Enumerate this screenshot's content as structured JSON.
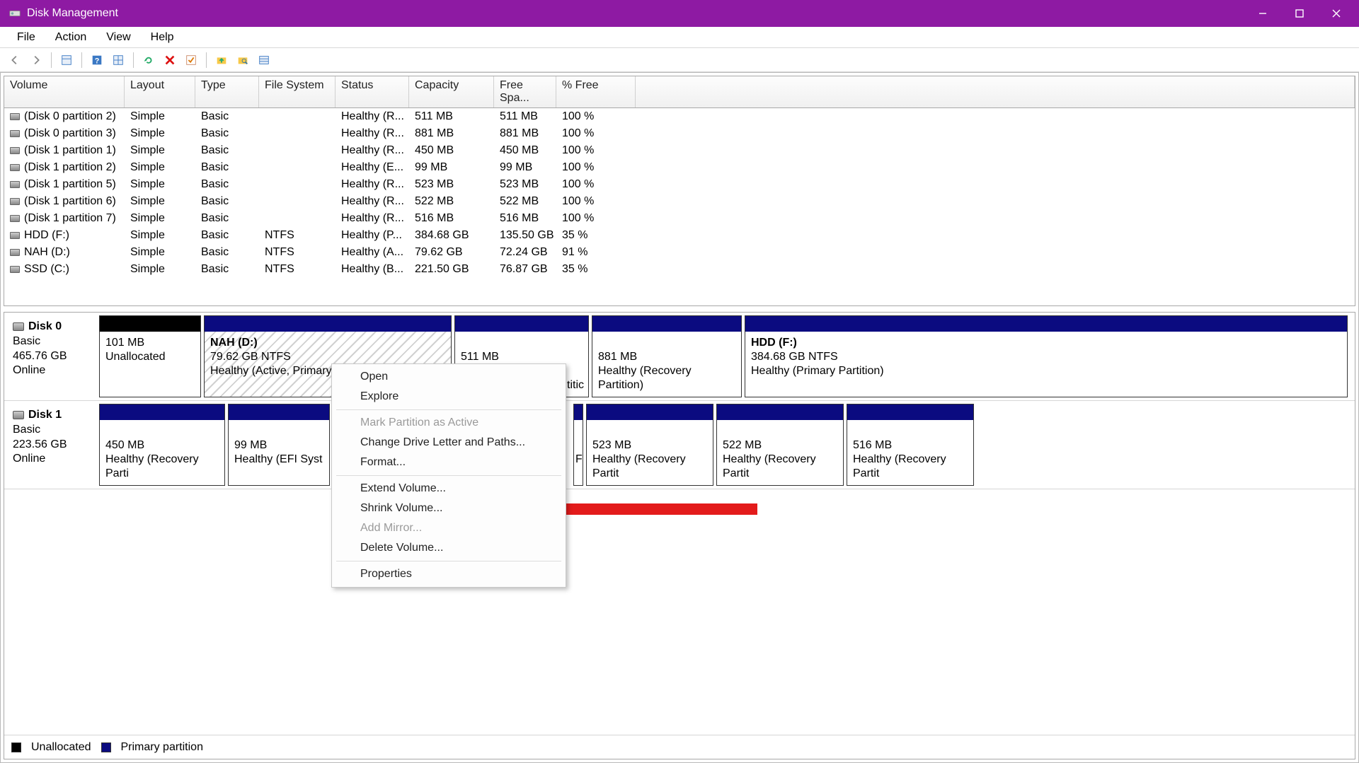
{
  "titlebar": {
    "title": "Disk Management"
  },
  "menubar": {
    "file": "File",
    "action": "Action",
    "view": "View",
    "help": "Help"
  },
  "columns": {
    "volume": "Volume",
    "layout": "Layout",
    "type": "Type",
    "fs": "File System",
    "status": "Status",
    "capacity": "Capacity",
    "free": "Free Spa...",
    "pct": "% Free"
  },
  "volumes": [
    {
      "name": "(Disk 0 partition 2)",
      "layout": "Simple",
      "type": "Basic",
      "fs": "",
      "status": "Healthy (R...",
      "capacity": "511 MB",
      "free": "511 MB",
      "pct": "100 %"
    },
    {
      "name": "(Disk 0 partition 3)",
      "layout": "Simple",
      "type": "Basic",
      "fs": "",
      "status": "Healthy (R...",
      "capacity": "881 MB",
      "free": "881 MB",
      "pct": "100 %"
    },
    {
      "name": "(Disk 1 partition 1)",
      "layout": "Simple",
      "type": "Basic",
      "fs": "",
      "status": "Healthy (R...",
      "capacity": "450 MB",
      "free": "450 MB",
      "pct": "100 %"
    },
    {
      "name": "(Disk 1 partition 2)",
      "layout": "Simple",
      "type": "Basic",
      "fs": "",
      "status": "Healthy (E...",
      "capacity": "99 MB",
      "free": "99 MB",
      "pct": "100 %"
    },
    {
      "name": "(Disk 1 partition 5)",
      "layout": "Simple",
      "type": "Basic",
      "fs": "",
      "status": "Healthy (R...",
      "capacity": "523 MB",
      "free": "523 MB",
      "pct": "100 %"
    },
    {
      "name": "(Disk 1 partition 6)",
      "layout": "Simple",
      "type": "Basic",
      "fs": "",
      "status": "Healthy (R...",
      "capacity": "522 MB",
      "free": "522 MB",
      "pct": "100 %"
    },
    {
      "name": "(Disk 1 partition 7)",
      "layout": "Simple",
      "type": "Basic",
      "fs": "",
      "status": "Healthy (R...",
      "capacity": "516 MB",
      "free": "516 MB",
      "pct": "100 %"
    },
    {
      "name": "HDD (F:)",
      "layout": "Simple",
      "type": "Basic",
      "fs": "NTFS",
      "status": "Healthy (P...",
      "capacity": "384.68 GB",
      "free": "135.50 GB",
      "pct": "35 %"
    },
    {
      "name": "NAH (D:)",
      "layout": "Simple",
      "type": "Basic",
      "fs": "NTFS",
      "status": "Healthy (A...",
      "capacity": "79.62 GB",
      "free": "72.24 GB",
      "pct": "91 %"
    },
    {
      "name": "SSD (C:)",
      "layout": "Simple",
      "type": "Basic",
      "fs": "NTFS",
      "status": "Healthy (B...",
      "capacity": "221.50 GB",
      "free": "76.87 GB",
      "pct": "35 %"
    }
  ],
  "disk0": {
    "title": "Disk 0",
    "type": "Basic",
    "size": "465.76 GB",
    "status": "Online",
    "partitions": [
      {
        "l1": "",
        "l2": "101 MB",
        "l3": "Unallocated"
      },
      {
        "title": "NAH  (D:)",
        "l2": "79.62 GB NTFS",
        "l3": "Healthy (Active, Primary "
      },
      {
        "l2": "511 MB",
        "l3cut": "titic"
      },
      {
        "l2": "881 MB",
        "l3": "Healthy (Recovery Partition)"
      },
      {
        "title": "HDD  (F:)",
        "l2": "384.68 GB NTFS",
        "l3": "Healthy (Primary Partition)"
      }
    ]
  },
  "disk1": {
    "title": "Disk 1",
    "type": "Basic",
    "size": "223.56 GB",
    "status": "Online",
    "partitions": [
      {
        "l2": "450 MB",
        "l3": "Healthy (Recovery Parti"
      },
      {
        "l2": "99 MB",
        "l3": "Healthy (EFI Syst"
      },
      {
        "space": true
      },
      {
        "cutR": "F"
      },
      {
        "l2": "523 MB",
        "l3": "Healthy (Recovery Partit"
      },
      {
        "l2": "522 MB",
        "l3": "Healthy (Recovery Partit"
      },
      {
        "l2": "516 MB",
        "l3": "Healthy (Recovery Partit"
      }
    ]
  },
  "legend": {
    "unallocated": "Unallocated",
    "primary": "Primary partition"
  },
  "context_menu": {
    "open": "Open",
    "explore": "Explore",
    "mark_active": "Mark Partition as Active",
    "change_letter": "Change Drive Letter and Paths...",
    "format": "Format...",
    "extend": "Extend Volume...",
    "shrink": "Shrink Volume...",
    "add_mirror": "Add Mirror...",
    "delete": "Delete Volume...",
    "properties": "Properties"
  }
}
